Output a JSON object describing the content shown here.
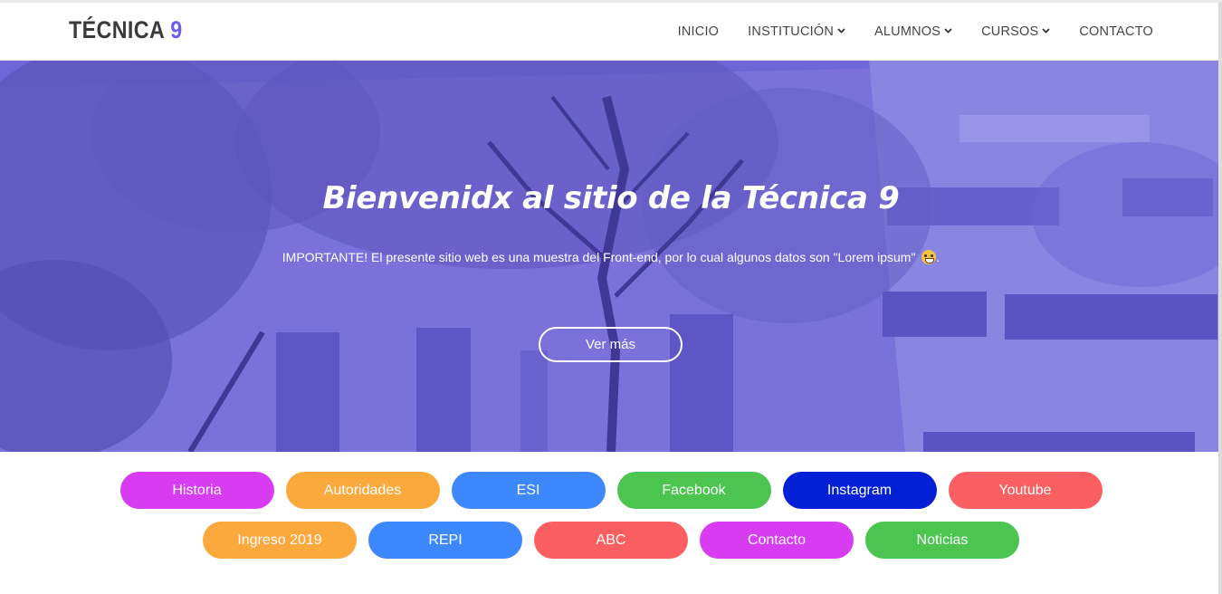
{
  "brand": {
    "text": "TÉCNICA",
    "accent": "9"
  },
  "nav": {
    "items": [
      {
        "label": "INICIO",
        "dropdown": false
      },
      {
        "label": "INSTITUCIÓN",
        "dropdown": true
      },
      {
        "label": "ALUMNOS",
        "dropdown": true
      },
      {
        "label": "CURSOS",
        "dropdown": true
      },
      {
        "label": "CONTACTO",
        "dropdown": false
      }
    ]
  },
  "hero": {
    "title": "Bienvenidx al sitio de la Técnica 9",
    "subtitle": "IMPORTANTE! El presente sitio web es una muestra del Front-end, por lo cual algunos datos son \"Lorem ipsum\"",
    "subtitle_end": ".",
    "emoji": "grinning-cat-emoji",
    "button": "Ver más",
    "overlay_color": "#6c63e0"
  },
  "pills": {
    "row1": [
      {
        "label": "Historia",
        "color": "#d83cf2"
      },
      {
        "label": "Autoridades",
        "color": "#fba93c"
      },
      {
        "label": "ESI",
        "color": "#3d88fc"
      },
      {
        "label": "Facebook",
        "color": "#4bc54f"
      },
      {
        "label": "Instagram",
        "color": "#0320d6"
      },
      {
        "label": "Youtube",
        "color": "#fb5f61"
      }
    ],
    "row2": [
      {
        "label": "Ingreso 2019",
        "color": "#fba93c"
      },
      {
        "label": "REPI",
        "color": "#3d88fc"
      },
      {
        "label": "ABC",
        "color": "#fb5f61"
      },
      {
        "label": "Contacto",
        "color": "#d83cf2"
      },
      {
        "label": "Noticias",
        "color": "#4bc54f"
      }
    ]
  }
}
